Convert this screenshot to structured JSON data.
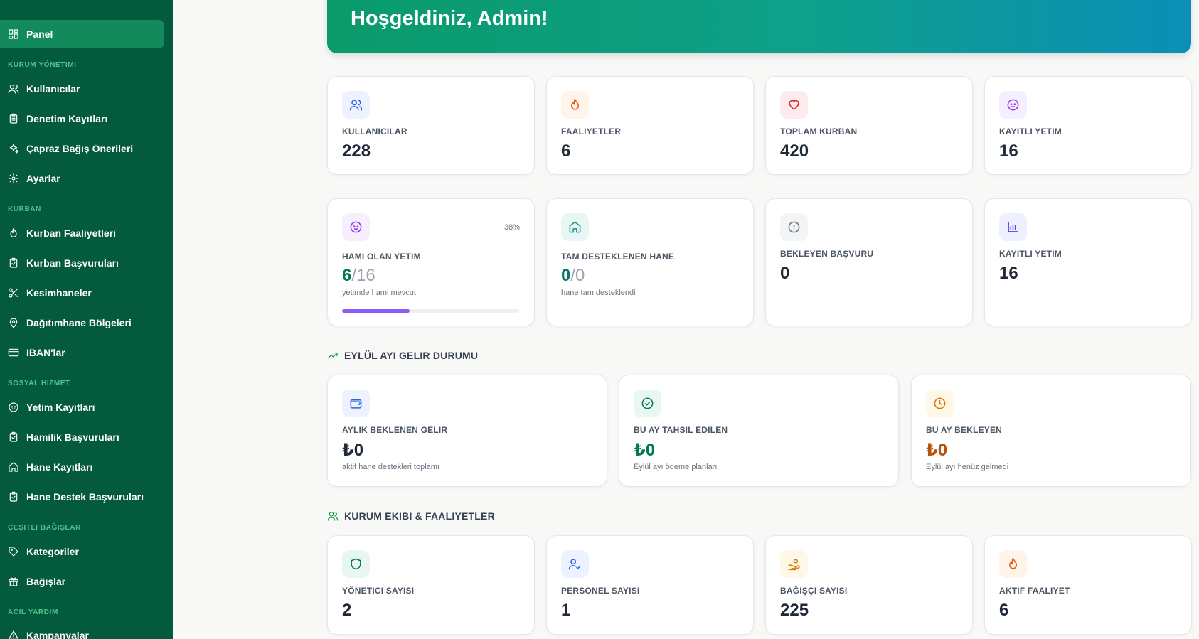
{
  "sidebar": {
    "active_item": "Panel",
    "items": [
      {
        "label": "Panel",
        "icon": "dashboard-icon"
      },
      {
        "label": "Kullanıcılar",
        "icon": "users-icon"
      },
      {
        "label": "Denetim Kayıtları",
        "icon": "clipboard-icon"
      },
      {
        "label": "Çapraz Bağış Önerileri",
        "icon": "sparkles-icon"
      },
      {
        "label": "Ayarlar",
        "icon": "gear-icon"
      },
      {
        "label": "Kurban Faaliyetleri",
        "icon": "flame-icon"
      },
      {
        "label": "Kurban Başvuruları",
        "icon": "clipboard-check-icon"
      },
      {
        "label": "Kesimhaneler",
        "icon": "scissors-icon"
      },
      {
        "label": "Dağıtımhane Bölgeleri",
        "icon": "map-pin-icon"
      },
      {
        "label": "IBAN'lar",
        "icon": "credit-card-icon"
      },
      {
        "label": "Yetim Kayıtları",
        "icon": "baby-icon"
      },
      {
        "label": "Hamilik Başvuruları",
        "icon": "clipboard-check-icon"
      },
      {
        "label": "Hane Kayıtları",
        "icon": "home-icon"
      },
      {
        "label": "Hane Destek Başvuruları",
        "icon": "clipboard-check-icon"
      },
      {
        "label": "Kategoriler",
        "icon": "tag-icon"
      },
      {
        "label": "Bağışlar",
        "icon": "gift-icon"
      },
      {
        "label": "Kampanyalar",
        "icon": "alert-triangle-icon"
      }
    ],
    "sections": [
      "KURUM YÖNETIMI",
      "KURBAN",
      "SOSYAL HIZMET",
      "ÇEŞITLI BAĞIŞLAR",
      "ACIL YARDIM"
    ]
  },
  "hero": {
    "title": "Hoşgeldiniz, Admin!"
  },
  "stats_row1": [
    {
      "label": "KULLANICILAR",
      "value": "228",
      "icon": "users-icon"
    },
    {
      "label": "FAALIYETLER",
      "value": "6",
      "icon": "flame-icon"
    },
    {
      "label": "TOPLAM KURBAN",
      "value": "420",
      "icon": "heart-icon"
    },
    {
      "label": "KAYITLI YETIM",
      "value": "16",
      "icon": "baby-icon"
    }
  ],
  "stats_row2": [
    {
      "label": "HAMI OLAN YETIM",
      "value_main": "6",
      "value_total": "/16",
      "sub": "yetimde hami mevcut",
      "percent_text": "38%",
      "progress": 0.38,
      "icon": "baby-icon"
    },
    {
      "label": "TAM DESTEKLENEN HANE",
      "value_main": "0",
      "value_total": "/0",
      "sub": "hane tam desteklendi",
      "icon": "home-icon"
    },
    {
      "label": "BEKLEYEN BAŞVURU",
      "value": "0",
      "icon": "alert-circle-icon"
    },
    {
      "label": "KAYITLI YETIM",
      "value": "16",
      "icon": "bar-chart-icon"
    }
  ],
  "income_section": {
    "title": "EYLÜL AYI GELIR DURUMU",
    "cards": [
      {
        "label": "AYLIK BEKLENEN GELIR",
        "value": "₺0",
        "sub": "aktif hane destekleri toplamı",
        "icon": "wallet-icon"
      },
      {
        "label": "BU AY TAHSIL EDILEN",
        "value": "₺0",
        "sub": "Eylül ayı ödeme planları",
        "icon": "check-circle-icon"
      },
      {
        "label": "BU AY BEKLEYEN",
        "value": "₺0",
        "sub": "Eylül ayı henüz gelmedi",
        "icon": "clock-icon"
      }
    ]
  },
  "team_section": {
    "title": "KURUM EKIBI & FAALIYETLER",
    "cards": [
      {
        "label": "YÖNETICI SAYISI",
        "value": "2",
        "icon": "shield-icon"
      },
      {
        "label": "PERSONEL SAYISI",
        "value": "1",
        "icon": "user-check-icon"
      },
      {
        "label": "BAĞIŞÇI SAYISI",
        "value": "225",
        "icon": "hand-coins-icon"
      },
      {
        "label": "AKTIF FAALIYET",
        "value": "6",
        "icon": "flame-icon"
      }
    ]
  },
  "colors": {
    "sidebar_bg": "#045a3d",
    "sidebar_active": "#138a5c",
    "section_heading": "#4ec38d",
    "green_value": "#047857",
    "orange_value": "#b45309",
    "progress_fill": "#8b5cf6"
  }
}
